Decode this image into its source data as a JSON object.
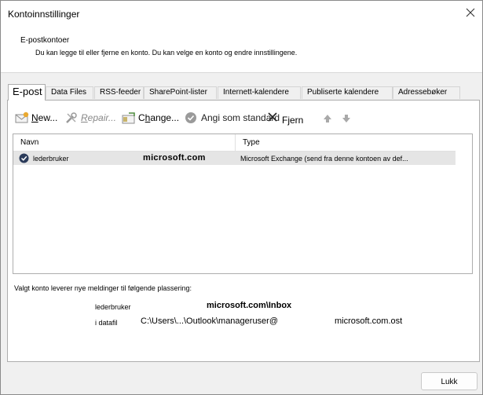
{
  "window": {
    "title": "Kontoinnstillinger"
  },
  "header": {
    "section": "E-postkontoer",
    "description": "Du kan legge til eller fjerne en konto. Du kan velge en konto og endre innstillingene."
  },
  "tabs": [
    {
      "label": "E-post"
    },
    {
      "label": "Data Files"
    },
    {
      "label": "RSS-feeder"
    },
    {
      "label": "SharePoint-lister"
    },
    {
      "label": "Internett-kalendere"
    },
    {
      "label": "Publiserte kalendere"
    },
    {
      "label": "Adressebøker"
    }
  ],
  "toolbar": {
    "new_label": "New...",
    "repair_label": "Repair...",
    "change_label": "Change...",
    "default_label": "Angi som standard",
    "remove_label": "Fjern"
  },
  "list": {
    "columns": [
      "Navn",
      "Type"
    ],
    "rows": [
      {
        "name": "lederbruker",
        "domain": "microsoft.com",
        "type": "Microsoft Exchange (send fra denne kontoen av def..."
      }
    ]
  },
  "delivery": {
    "label": "Valgt konto leverer nye meldinger til følgende plassering:",
    "account": "lederbruker",
    "inbox": "microsoft.com\\Inbox",
    "datafile_label": "i datafil",
    "datafile_path": "C:\\Users\\...\\Outlook\\manageruser@",
    "datafile_domain": "microsoft.com.ost"
  },
  "footer": {
    "close_label": "Lukk"
  }
}
